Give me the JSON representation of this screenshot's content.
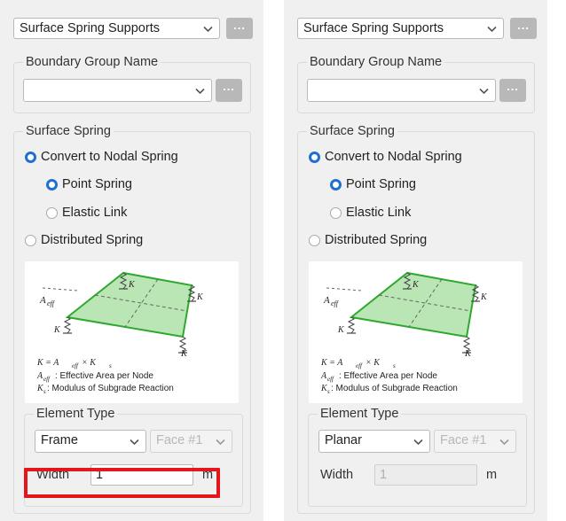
{
  "panels": [
    {
      "support_type": "Surface Spring Supports",
      "browse_label": "...",
      "boundary_group": {
        "title": "Boundary Group Name",
        "value": "",
        "browse_label": "..."
      },
      "surface_spring": {
        "title": "Surface Spring",
        "options": {
          "convert": {
            "label": "Convert to Nodal Spring",
            "selected": true
          },
          "point": {
            "label": "Point Spring",
            "selected": true
          },
          "elastic": {
            "label": "Elastic Link",
            "selected": false
          },
          "distributed": {
            "label": "Distributed Spring",
            "selected": false
          }
        }
      },
      "element_type": {
        "title": "Element Type",
        "type_value": "Frame",
        "face_value": "Face #1",
        "width_label": "Width",
        "width_value": "1",
        "width_unit": "m",
        "width_enabled": true
      }
    },
    {
      "support_type": "Surface Spring Supports",
      "browse_label": "...",
      "boundary_group": {
        "title": "Boundary Group Name",
        "value": "",
        "browse_label": "..."
      },
      "surface_spring": {
        "title": "Surface Spring",
        "options": {
          "convert": {
            "label": "Convert to Nodal Spring",
            "selected": true
          },
          "point": {
            "label": "Point Spring",
            "selected": true
          },
          "elastic": {
            "label": "Elastic Link",
            "selected": false
          },
          "distributed": {
            "label": "Distributed Spring",
            "selected": false
          }
        }
      },
      "element_type": {
        "title": "Element Type",
        "type_value": "Planar",
        "face_value": "Face #1",
        "width_label": "Width",
        "width_value": "1",
        "width_unit": "m",
        "width_enabled": false
      }
    }
  ],
  "figure": {
    "spring_label": "K",
    "aeff_label": "A",
    "aeff_sub": "eff",
    "formula": "K = A",
    "formula_sub1": "eff",
    "formula_tail": " × K",
    "formula_sub2": "s",
    "legend_aeff": " : Effective Area per Node",
    "legend_ks": " : Modulus of Subgrade Reaction",
    "plate_fill": "#b9e6b4",
    "plate_stroke": "#2ea82e"
  },
  "colors": {
    "highlight": "#e3161c",
    "radio_accent": "#1f6fd1"
  }
}
